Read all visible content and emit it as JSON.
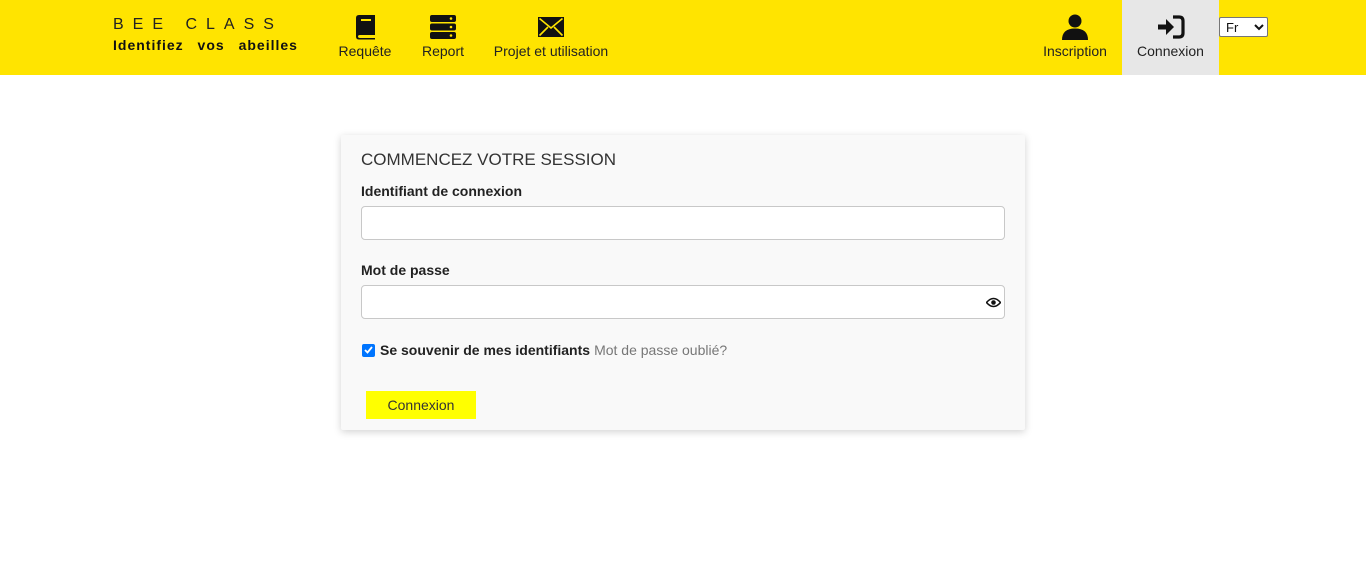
{
  "brand": {
    "title": "BEE CLASS",
    "subtitle": "Identifiez vos abeilles"
  },
  "nav": {
    "left": [
      {
        "label": "Requête",
        "icon": "book-icon"
      },
      {
        "label": "Report",
        "icon": "server-icon"
      },
      {
        "label": "Projet et utilisation",
        "icon": "envelope-icon"
      }
    ],
    "right": [
      {
        "label": "Inscription",
        "icon": "user-icon"
      },
      {
        "label": "Connexion",
        "icon": "sign-in-icon",
        "active": true
      }
    ],
    "language": {
      "selected": "Fr",
      "options": [
        "Fr"
      ]
    }
  },
  "login": {
    "title": "COMMENCEZ VOTRE SESSION",
    "username_label": "Identifiant de connexion",
    "username_value": "",
    "password_label": "Mot de passe",
    "password_value": "",
    "remember_label": "Se souvenir de mes identifiants",
    "remember_checked": true,
    "forgot_label": "Mot de passe oublié?",
    "submit_label": "Connexion"
  },
  "colors": {
    "navbar": "#ffe400",
    "active_nav": "#e7e7e7",
    "button": "#ffff00",
    "checkbox": "#0075ff"
  }
}
